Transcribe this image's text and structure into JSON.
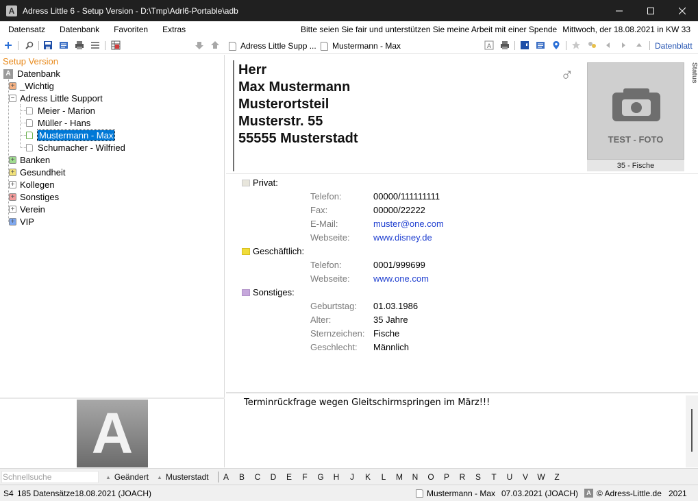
{
  "window": {
    "title": "Adress Little 6 - Setup Version - D:\\Tmp\\Adrl6-Portable\\adb",
    "icon": "app-logo-icon"
  },
  "menu": {
    "items": [
      "Datensatz",
      "Datenbank",
      "Favoriten",
      "Extras"
    ],
    "donate_text": "Bitte seien Sie fair und unterstützen Sie meine Arbeit mit einer Spende",
    "date_text": "Mittwoch, der 18.08.2021 in KW 33"
  },
  "toolbar": {
    "tab1_label": "Adress Little Supp ...",
    "tab2_label": "Mustermann - Max",
    "datenblatt_label": "Datenblatt"
  },
  "tree": {
    "setup_label": "Setup Version",
    "root_label": "Datenbank",
    "groups": [
      {
        "label": "_Wichtig",
        "color": "#f4b183"
      },
      {
        "label": "Adress Little Support",
        "color": "#ffffff"
      },
      {
        "label": "Banken",
        "color": "#9fdc8f"
      },
      {
        "label": "Gesundheit",
        "color": "#f2e27a"
      },
      {
        "label": "Kollegen",
        "color": "#ffffff"
      },
      {
        "label": "Sonstiges",
        "color": "#f29a9a"
      },
      {
        "label": "Verein",
        "color": "#ffffff"
      },
      {
        "label": "VIP",
        "color": "#7ea8f0"
      }
    ],
    "contacts": [
      "Meier - Marion",
      "Müller - Hans",
      "Mustermann - Max",
      "Schumacher - Wilfried"
    ],
    "selected_contact": "Mustermann - Max"
  },
  "contact": {
    "address_lines": [
      "Herr",
      "Max Mustermann",
      "Musterortsteil",
      "Musterstr. 55",
      "55555 Musterstadt"
    ],
    "gender_symbol": "♂",
    "photo_text": "TEST - FOTO",
    "photo_caption": "35 - Fische",
    "status_label": "Status",
    "sections": {
      "privat": {
        "title": "Privat:",
        "color": "#e8e6dc",
        "fields": [
          {
            "label": "Telefon:",
            "value": "00000/111111111"
          },
          {
            "label": "Fax:",
            "value": "00000/22222"
          },
          {
            "label": "E-Mail:",
            "value": "muster@one.com"
          },
          {
            "label": "Webseite:",
            "value": "www.disney.de"
          }
        ]
      },
      "geschaeftlich": {
        "title": "Geschäftlich:",
        "color": "#f0dc3a",
        "fields": [
          {
            "label": "Telefon:",
            "value": "0001/999699"
          },
          {
            "label": "Webseite:",
            "value": "www.one.com"
          }
        ]
      },
      "sonstiges": {
        "title": "Sonstiges:",
        "color": "#c6a8dc",
        "fields": [
          {
            "label": "Geburtstag:",
            "value": "01.03.1986"
          },
          {
            "label": "Alter:",
            "value": "35 Jahre"
          },
          {
            "label": "Sternzeichen:",
            "value": "Fische"
          },
          {
            "label": "Geschlecht:",
            "value": "Männlich"
          }
        ]
      }
    },
    "notes": "Terminrückfrage wegen Gleitschirmspringen im März!!!"
  },
  "alphabar": {
    "search_placeholder": "Schnellsuche",
    "sort1": "Geändert",
    "sort2": "Musterstadt",
    "letters": [
      "A",
      "B",
      "C",
      "D",
      "E",
      "F",
      "G",
      "H",
      "J",
      "K",
      "L",
      "M",
      "N",
      "O",
      "P",
      "R",
      "S",
      "T",
      "U",
      "V",
      "W",
      "Z"
    ]
  },
  "statusbar": {
    "db": "S4",
    "count": "185 Datensätze",
    "date_user": "18.08.2021 (JOACH)",
    "record": "Mustermann - Max",
    "record_date": "07.03.2021 (JOACH)",
    "copyright": "© Adress-Little.de",
    "year": "2021"
  }
}
